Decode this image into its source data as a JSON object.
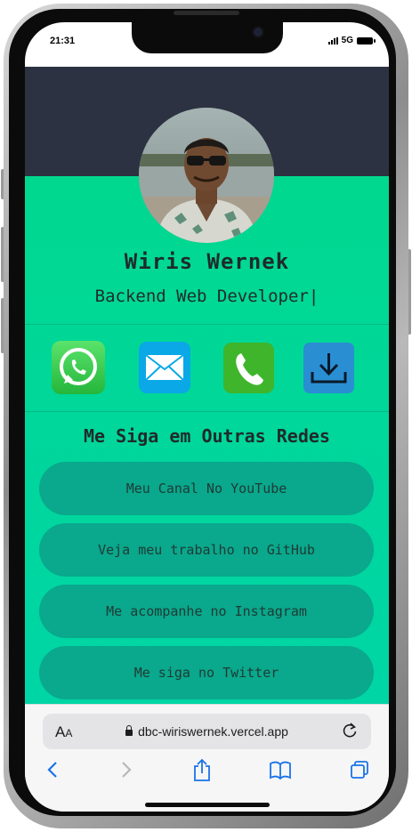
{
  "status_bar": {
    "time": "21:31",
    "network": "5G"
  },
  "profile": {
    "name": "Wiris Wernek",
    "role": "Backend Web Developer|"
  },
  "contact_icons": [
    "whatsapp-icon",
    "mail-icon",
    "phone-icon",
    "download-icon"
  ],
  "social": {
    "title": "Me Siga em Outras Redes",
    "links": [
      {
        "label": "Meu Canal No YouTube"
      },
      {
        "label": "Veja meu trabalho no GitHub"
      },
      {
        "label": "Me acompanhe no Instagram"
      },
      {
        "label": "Me siga no Twitter"
      }
    ]
  },
  "browser": {
    "text_size_label": "A",
    "text_size_label_small": "A",
    "url": "dbc-wiriswernek.vercel.app"
  },
  "colors": {
    "header_dark": "#2c3241",
    "accent_green": "#00d98b",
    "button_green": "#0aa88c",
    "whatsapp": "#25b63c",
    "mail": "#0aa8e7",
    "phone": "#3fb52c",
    "download": "#2a8ed3"
  }
}
